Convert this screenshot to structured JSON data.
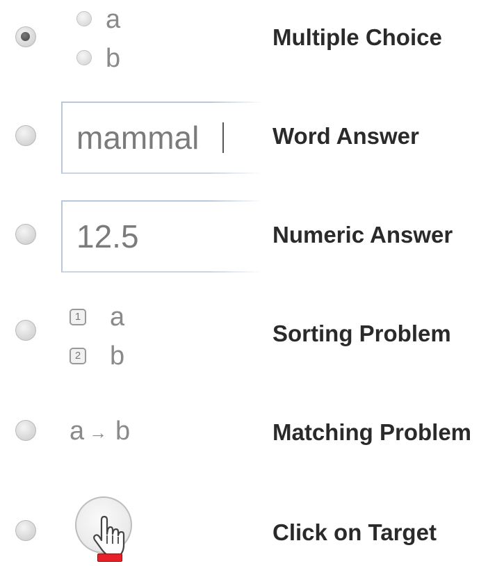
{
  "question_types": [
    {
      "label": "Multiple Choice",
      "selected": true,
      "sample": {
        "options": [
          "a",
          "b"
        ]
      }
    },
    {
      "label": "Word Answer",
      "selected": false,
      "sample": {
        "value": "mammal"
      }
    },
    {
      "label": "Numeric Answer",
      "selected": false,
      "sample": {
        "value": "12.5"
      }
    },
    {
      "label": "Sorting Problem",
      "selected": false,
      "sample": {
        "items": [
          {
            "rank": "1",
            "text": "a"
          },
          {
            "rank": "2",
            "text": "b"
          }
        ]
      }
    },
    {
      "label": "Matching Problem",
      "selected": false,
      "sample": {
        "from": "a",
        "arrow": "→",
        "to": "b"
      }
    },
    {
      "label": "Click on Target",
      "selected": false,
      "sample": {
        "icon": "hand-pointer-icon"
      }
    }
  ],
  "colors": {
    "label_text": "#2a2a2a",
    "sample_text": "#888888",
    "field_border": "#b8c8da",
    "target_marker": "#e8202a"
  }
}
